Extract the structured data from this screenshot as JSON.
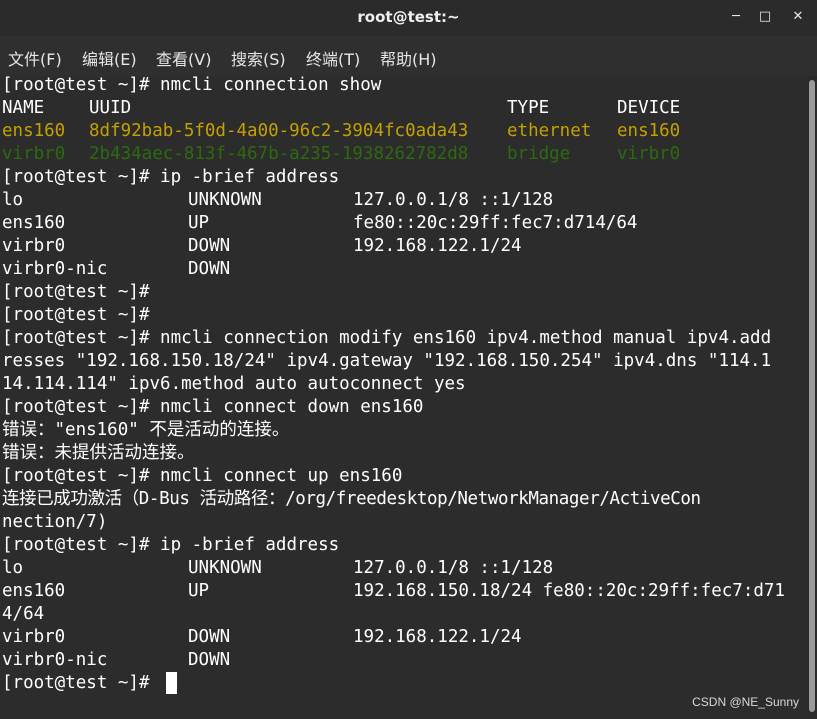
{
  "window": {
    "title": "root@test:~",
    "minimize_glyph": "─",
    "maximize_glyph": "□",
    "close_glyph": "✕"
  },
  "menubar": {
    "items": [
      "文件(F)",
      "编辑(E)",
      "查看(V)",
      "搜索(S)",
      "终端(T)",
      "帮助(H)"
    ]
  },
  "colors": {
    "active_connection": "#c4a000",
    "bridge_connection": "#2d6a0f",
    "text": "#ffffff",
    "background": "#2c2c2c"
  },
  "terminal": {
    "l1": "[root@test ~]# nmcli connection show",
    "l2": {
      "c1": "NAME",
      "c2": "UUID",
      "c3": "TYPE",
      "c4": "DEVICE"
    },
    "l3": {
      "c1": "ens160",
      "c2": "8df92bab-5f0d-4a00-96c2-3904fc0ada43",
      "c3": "ethernet",
      "c4": "ens160"
    },
    "l4": {
      "c1": "virbr0",
      "c2": "2b434aec-813f-467b-a235-1938262782d8",
      "c3": "bridge",
      "c4": "virbr0"
    },
    "l5": "[root@test ~]# ip -brief address",
    "l6": {
      "c1": "lo",
      "c2": "UNKNOWN",
      "c3": "127.0.0.1/8 ::1/128"
    },
    "l7": {
      "c1": "ens160",
      "c2": "UP",
      "c3": "fe80::20c:29ff:fec7:d714/64"
    },
    "l8": {
      "c1": "virbr0",
      "c2": "DOWN",
      "c3": "192.168.122.1/24"
    },
    "l9": {
      "c1": "virbr0-nic",
      "c2": "DOWN"
    },
    "l10": "[root@test ~]#",
    "l11": "[root@test ~]#",
    "l12": "[root@test ~]# nmcli connection modify ens160 ipv4.method manual ipv4.add",
    "l13": "resses \"192.168.150.18/24\" ipv4.gateway \"192.168.150.254\" ipv4.dns \"114.1",
    "l14": "14.114.114\" ipv6.method auto autoconnect yes",
    "l15": "[root@test ~]# nmcli connect down ens160",
    "l16": "错误：\"ens160\" 不是活动的连接。",
    "l17": "错误：未提供活动连接。",
    "l18": "[root@test ~]# nmcli connect up ens160",
    "l19": "连接已成功激活（D-Bus 活动路径：/org/freedesktop/NetworkManager/ActiveCon",
    "l20": "nection/7)",
    "l21": "[root@test ~]# ip -brief address",
    "l22": {
      "c1": "lo",
      "c2": "UNKNOWN",
      "c3": "127.0.0.1/8 ::1/128"
    },
    "l23": {
      "c1": "ens160",
      "c2": "UP",
      "c3": "192.168.150.18/24 fe80::20c:29ff:fec7:d71"
    },
    "l24": "4/64",
    "l25": {
      "c1": "virbr0",
      "c2": "DOWN",
      "c3": "192.168.122.1/24"
    },
    "l26": {
      "c1": "virbr0-nic",
      "c2": "DOWN"
    },
    "l27": "[root@test ~]#"
  },
  "watermark": "CSDN @NE_Sunny"
}
